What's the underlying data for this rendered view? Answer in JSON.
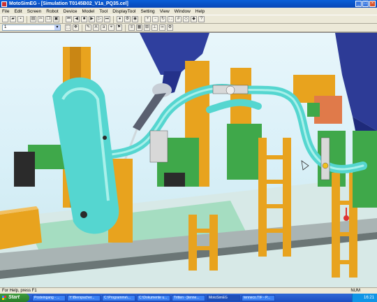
{
  "window": {
    "title": "MotoSimEG - [Simulation T0145B02_V1a_PQ35.cel]",
    "controls": [
      "_",
      "□",
      "×"
    ]
  },
  "menu": [
    "File",
    "Edit",
    "Screen",
    "Robot",
    "Device",
    "Model",
    "Tool",
    "DisplayTool",
    "Setting",
    "View",
    "Window",
    "Help"
  ],
  "toolbar": {
    "icons": [
      "new-icon",
      "open-icon",
      "save-icon",
      "print-icon",
      "cut-icon",
      "copy-icon",
      "paste-icon",
      "rewind-icon",
      "step-back-icon",
      "stop-icon",
      "play-icon",
      "step-forward-icon",
      "fast-forward-icon",
      "record-icon",
      "teach-icon",
      "camera-icon",
      "zoom-in-icon",
      "zoom-out-icon",
      "rotate-icon",
      "fit-icon",
      "grid-icon",
      "wireframe-icon",
      "shade-icon",
      "help-icon"
    ]
  },
  "toolbar2": {
    "combo_value": "1",
    "icons": [
      "select-icon",
      "move-icon",
      "pen-icon",
      "text-icon",
      "font-icon",
      "measure-icon",
      "marker-icon",
      "layer-icon",
      "color-icon",
      "frame-icon",
      "axis-icon",
      "link-icon",
      "settings-icon"
    ]
  },
  "status": {
    "help_text": "For Help, press F1",
    "num": "NUM"
  },
  "taskbar": {
    "start_label": "Start",
    "tasks": [
      "Posteingang - ...",
      "Y:\\Bierspacher...",
      "C:\\Programme\\...",
      "C:\\Dokumente u...",
      "Tritten - [tenne...",
      "MotoSimEG",
      "tenneco.TIF - P..."
    ],
    "active_task_index": 5,
    "clock": "16:21"
  },
  "colors": {
    "pipe": "#55d6d0",
    "fixture": "#e8a31e",
    "frame_green": "#3fa84a",
    "robot_blue": "#2f3f9e",
    "background": "#dff2f8"
  }
}
